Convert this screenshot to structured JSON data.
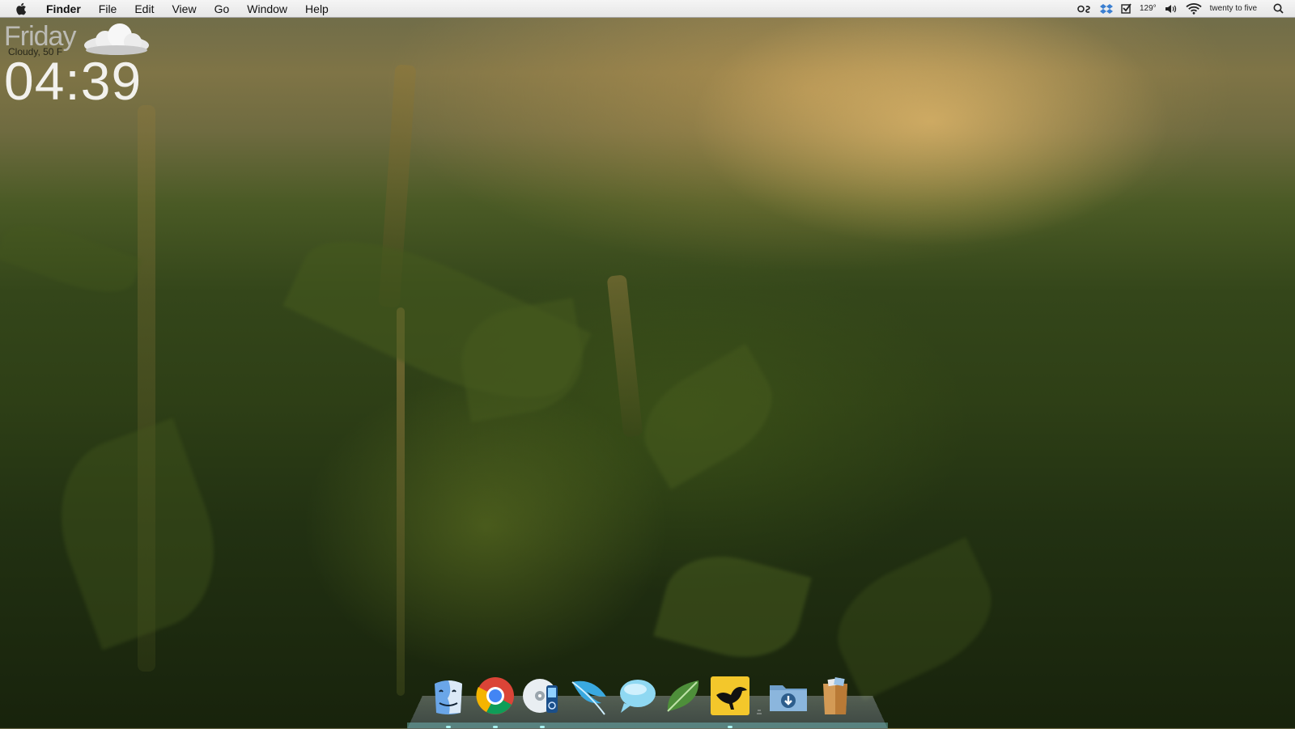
{
  "menubar": {
    "app_name": "Finder",
    "menus": [
      "File",
      "Edit",
      "View",
      "Go",
      "Window",
      "Help"
    ],
    "status": {
      "temperature": "129°",
      "clock_text": "twenty to five"
    }
  },
  "widget": {
    "day": "Friday",
    "condition": "Cloudy, 50 F",
    "time": "04:39"
  },
  "dock": {
    "items": [
      {
        "icon": "finder-icon",
        "running": true
      },
      {
        "icon": "chrome-icon",
        "running": true
      },
      {
        "icon": "itunes-icon",
        "running": true
      },
      {
        "icon": "feather-icon",
        "running": false
      },
      {
        "icon": "messages-bubble-icon",
        "running": false
      },
      {
        "icon": "leaf-icon",
        "running": false
      },
      {
        "icon": "bird-icon",
        "running": true
      },
      {
        "icon": "downloads-folder-icon",
        "running": false
      },
      {
        "icon": "trash-icon",
        "running": false
      }
    ]
  }
}
